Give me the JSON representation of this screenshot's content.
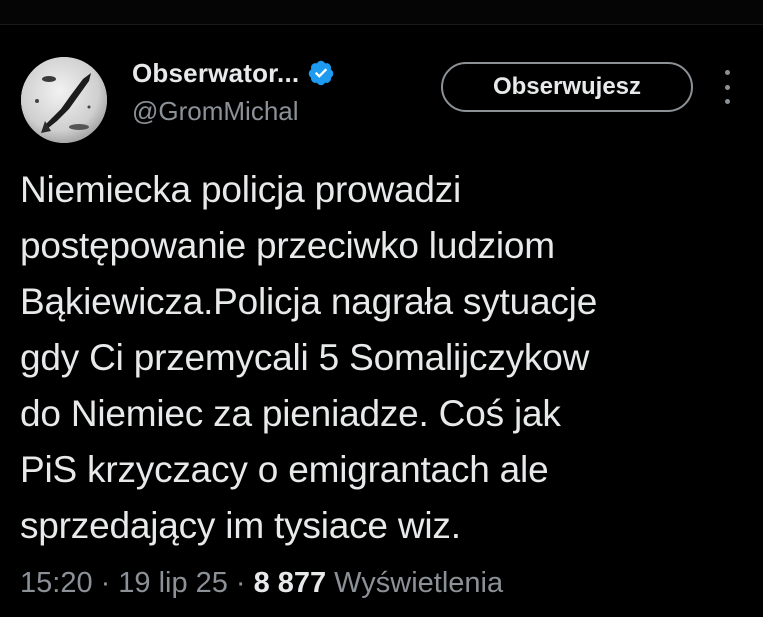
{
  "account": {
    "display_name": "Obserwator...",
    "handle": "@GromMichal",
    "verified_color": "#1d9bf0"
  },
  "follow_button": {
    "label": "Obserwujesz"
  },
  "more_menu": {
    "icon": "more-vertical-icon"
  },
  "tweet": {
    "lines": [
      "Niemiecka policja prowadzi",
      "postępowanie przeciwko ludziom",
      "Bąkiewicza.Policja  nagrała sytuacje",
      "gdy Ci przemycali 5 Somalijczykow",
      "do Niemiec za pieniadze. Coś jak",
      "PiS krzyczacy o emigrantach ale",
      "sprzedający im tysiace wiz."
    ]
  },
  "meta": {
    "time": "15:20",
    "separator": "·",
    "date": "19 lip 25",
    "views_count": "8 877",
    "views_label": "Wyświetlenia"
  },
  "colors": {
    "background": "#000000",
    "primary_text": "#e7e9ea",
    "secondary_text": "#8b9197",
    "verified": "#1d9bf0"
  }
}
